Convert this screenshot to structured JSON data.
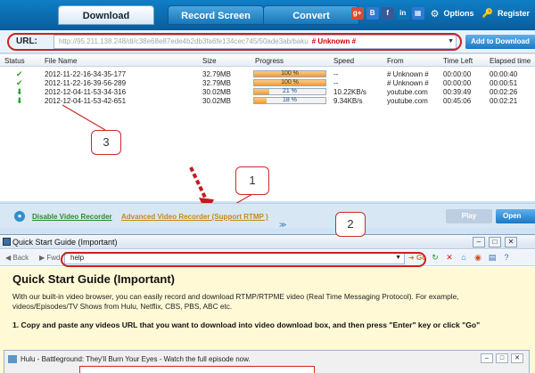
{
  "tabs": [
    "Download",
    "Record Screen",
    "Convert"
  ],
  "tray": {
    "icons": [
      {
        "name": "google-plus-icon",
        "glyph": "g+",
        "color": "#d94a36"
      },
      {
        "name": "blogger-icon",
        "glyph": "B",
        "color": "#2f7ad3"
      },
      {
        "name": "facebook-icon",
        "glyph": "f",
        "color": "#3b5998"
      },
      {
        "name": "linkedin-icon",
        "glyph": "in",
        "color": "#0a76b4"
      },
      {
        "name": "windows-icon",
        "glyph": "▦",
        "color": "#2f7ad3"
      }
    ],
    "options_label": "Options",
    "register_label": "Register"
  },
  "url_bar": {
    "label": "URL:",
    "value": "http://95.211.138.248/dl/c38e68e87ede4b2db3fa6fe134cec745/50ade3ab/baku",
    "tag": "# Unknown #",
    "add_button": "Add to Download"
  },
  "table": {
    "headers": [
      "Status",
      "File Name",
      "Size",
      "Progress",
      "Speed",
      "From",
      "Time Left",
      "Elapsed time"
    ],
    "rows": [
      {
        "status": "done",
        "file": "2012-11-22-16-34-35-177",
        "size": "32.79MB",
        "progress": "100 %",
        "progress_value": 1.0,
        "speed": "--",
        "from": "# Unknown #",
        "time_left": "00:00:00",
        "elapsed": "00:00:40"
      },
      {
        "status": "done",
        "file": "2012-11-22-16-39-56-289",
        "size": "32.79MB",
        "progress": "100 %",
        "progress_value": 1.0,
        "speed": "--",
        "from": "# Unknown #",
        "time_left": "00:00:00",
        "elapsed": "00:00:51"
      },
      {
        "status": "downloading",
        "file": "2012-12-04-11-53-34-316",
        "size": "30.02MB",
        "progress": "21 %",
        "progress_value": 0.21,
        "speed": "10.22KB/s",
        "from": "youtube.com",
        "time_left": "00:39:49",
        "elapsed": "00:02:26"
      },
      {
        "status": "downloading",
        "file": "2012-12-04-11-53-42-651",
        "size": "30.02MB",
        "progress": "18 %",
        "progress_value": 0.18,
        "speed": "9.34KB/s",
        "from": "youtube.com",
        "time_left": "00:45:06",
        "elapsed": "00:02:21"
      }
    ]
  },
  "bottom_bar": {
    "disable_link": "Disable Video Recorder",
    "advanced_link": "Advanced Video Recorder (Support RTMP )",
    "play_button": "Play",
    "open_button": "Open Folder"
  },
  "callouts": [
    "1",
    "2",
    "3"
  ],
  "guide": {
    "title": "Quick Start Guide (Important)",
    "back": "Back",
    "forward": "Fwd",
    "address": "help",
    "go": "Go",
    "heading": "Quick Start Guide (Important)",
    "intro": "With our built-in video browser, you can easily record and download RTMP/RTPME video (Real Time Messaging Protocol). For example, videos/Episodes/TV Shows from Hulu, Netflix, CBS, PBS, ABC etc.",
    "step1": "1. Copy and paste any videos URL that you want to download into video download box, and then press \"Enter\" key or click \"Go\"",
    "sub_window_title": "Hulu - Battleground: They'll Burn Your Eyes - Watch the full episode now."
  }
}
